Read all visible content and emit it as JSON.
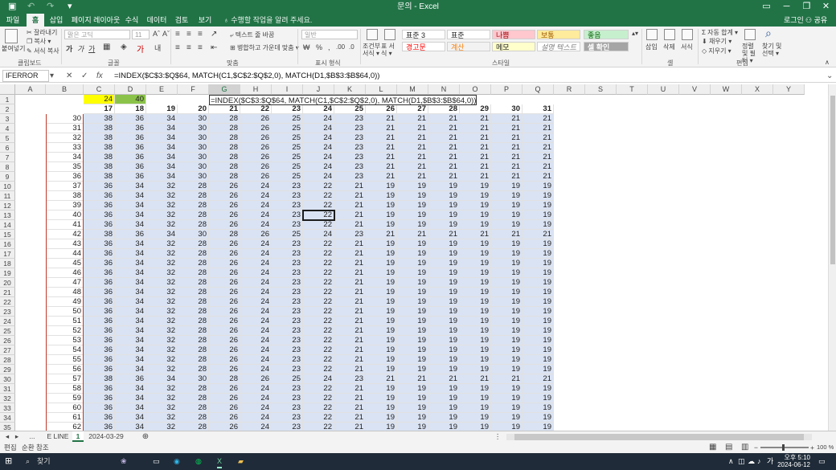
{
  "window": {
    "title": "문의 - Excel"
  },
  "tabs": [
    "파일",
    "홈",
    "삽입",
    "페이지 레이아웃",
    "수식",
    "데이터",
    "검토",
    "보기"
  ],
  "active_tab": "홈",
  "tell_me": "수행할 작업을 알려 주세요.",
  "login": "로그인",
  "share": "공유",
  "ribbon": {
    "paste": "붙여넣기",
    "cut": "잘라내기",
    "copy": "복사 ▾",
    "format_painter": "서식 복사",
    "font_name": "맑은 고딕",
    "font_size": "11",
    "wrap_text": "텍스트 줄 바꿈",
    "merge_center": "병합하고 가운데 맞춤 ▾",
    "number_format": "일반",
    "cond_format": "조건부 서식 ▾",
    "table_format": "표 서식 ▾",
    "styles": [
      {
        "label": "표준 3",
        "bg": "#ffffff",
        "fg": "#222222"
      },
      {
        "label": "표준",
        "bg": "#ffffff",
        "fg": "#222222"
      },
      {
        "label": "나쁨",
        "bg": "#ffc7ce",
        "fg": "#9c0006"
      },
      {
        "label": "보통",
        "bg": "#ffeb9c",
        "fg": "#9c5700"
      },
      {
        "label": "좋음",
        "bg": "#c6efce",
        "fg": "#006100"
      },
      {
        "label": "경고문",
        "bg": "#ffffff",
        "fg": "#ff0000"
      },
      {
        "label": "계산",
        "bg": "#f2f2f2",
        "fg": "#fa7d00"
      },
      {
        "label": "메모",
        "bg": "#ffffcc",
        "fg": "#222222"
      },
      {
        "label": "설명 텍스트",
        "bg": "#ffffff",
        "fg": "#7f7f7f"
      },
      {
        "label": "셀 확인",
        "bg": "#a5a5a5",
        "fg": "#ffffff"
      }
    ],
    "insert": "삽입",
    "delete": "삭제",
    "format": "서식",
    "autosum": "자동 합계 ▾",
    "fill": "채우기 ▾",
    "clear": "지우기 ▾",
    "sort_filter": "정렬 및 필터 ▾",
    "find_select": "찾기 및 선택 ▾",
    "groups": [
      "클립보드",
      "글꼴",
      "맞춤",
      "표시 형식",
      "스타일",
      "셀",
      "편집"
    ]
  },
  "formula_bar": {
    "name_box": "IFERROR",
    "cancel": "✕",
    "enter": "✓",
    "fx": "fx",
    "formula": "=INDEX($C$3:$Q$64, MATCH(C1,$C$2:$Q$2,0), MATCH(D1,$B$3:$B$64,0))"
  },
  "grid": {
    "columns": [
      "A",
      "B",
      "C",
      "D",
      "E",
      "F",
      "G",
      "H",
      "I",
      "J",
      "K",
      "L",
      "M",
      "N",
      "O",
      "P",
      "Q",
      "R",
      "S",
      "T",
      "U",
      "V",
      "W",
      "X",
      "Y"
    ],
    "row_numbers": [
      1,
      2,
      3,
      4,
      5,
      6,
      7,
      8,
      9,
      10,
      11,
      12,
      13,
      14,
      15,
      16,
      17,
      18,
      19,
      20,
      21,
      22,
      23,
      24,
      25,
      26,
      27,
      28,
      29,
      30,
      31,
      32,
      33,
      34,
      35
    ],
    "c1": "24",
    "d1": "40",
    "row2": [
      "17",
      "18",
      "19",
      "20",
      "21",
      "22",
      "23",
      "24",
      "25",
      "26",
      "27",
      "28",
      "29",
      "30",
      "31"
    ],
    "edit_text": "=INDEX($C$3:$Q$64, MATCH(C1,$C$2:$Q$2,0), MATCH(D1,$B$3:$B$64,0))",
    "rows": [
      {
        "b": "30",
        "v": [
          "38",
          "36",
          "34",
          "30",
          "28",
          "26",
          "25",
          "24",
          "23",
          "21",
          "21",
          "21",
          "21",
          "21",
          "21"
        ]
      },
      {
        "b": "31",
        "v": [
          "38",
          "36",
          "34",
          "30",
          "28",
          "26",
          "25",
          "24",
          "23",
          "21",
          "21",
          "21",
          "21",
          "21",
          "21"
        ]
      },
      {
        "b": "32",
        "v": [
          "38",
          "36",
          "34",
          "30",
          "28",
          "26",
          "25",
          "24",
          "23",
          "21",
          "21",
          "21",
          "21",
          "21",
          "21"
        ]
      },
      {
        "b": "33",
        "v": [
          "38",
          "36",
          "34",
          "30",
          "28",
          "26",
          "25",
          "24",
          "23",
          "21",
          "21",
          "21",
          "21",
          "21",
          "21"
        ]
      },
      {
        "b": "34",
        "v": [
          "38",
          "36",
          "34",
          "30",
          "28",
          "26",
          "25",
          "24",
          "23",
          "21",
          "21",
          "21",
          "21",
          "21",
          "21"
        ]
      },
      {
        "b": "35",
        "v": [
          "38",
          "36",
          "34",
          "30",
          "28",
          "26",
          "25",
          "24",
          "23",
          "21",
          "21",
          "21",
          "21",
          "21",
          "21"
        ]
      },
      {
        "b": "36",
        "v": [
          "38",
          "36",
          "34",
          "30",
          "28",
          "26",
          "25",
          "24",
          "23",
          "21",
          "21",
          "21",
          "21",
          "21",
          "21"
        ]
      },
      {
        "b": "37",
        "v": [
          "36",
          "34",
          "32",
          "28",
          "26",
          "24",
          "23",
          "22",
          "21",
          "19",
          "19",
          "19",
          "19",
          "19",
          "19"
        ]
      },
      {
        "b": "38",
        "v": [
          "36",
          "34",
          "32",
          "28",
          "26",
          "24",
          "23",
          "22",
          "21",
          "19",
          "19",
          "19",
          "19",
          "19",
          "19"
        ]
      },
      {
        "b": "39",
        "v": [
          "36",
          "34",
          "32",
          "28",
          "26",
          "24",
          "23",
          "22",
          "21",
          "19",
          "19",
          "19",
          "19",
          "19",
          "19"
        ]
      },
      {
        "b": "40",
        "v": [
          "36",
          "34",
          "32",
          "28",
          "26",
          "24",
          "23",
          "22",
          "21",
          "19",
          "19",
          "19",
          "19",
          "19",
          "19"
        ]
      },
      {
        "b": "41",
        "v": [
          "36",
          "34",
          "32",
          "28",
          "26",
          "24",
          "23",
          "22",
          "21",
          "19",
          "19",
          "19",
          "19",
          "19",
          "19"
        ]
      },
      {
        "b": "42",
        "v": [
          "38",
          "36",
          "34",
          "30",
          "28",
          "26",
          "25",
          "24",
          "23",
          "21",
          "21",
          "21",
          "21",
          "21",
          "21"
        ]
      },
      {
        "b": "43",
        "v": [
          "36",
          "34",
          "32",
          "28",
          "26",
          "24",
          "23",
          "22",
          "21",
          "19",
          "19",
          "19",
          "19",
          "19",
          "19"
        ]
      },
      {
        "b": "44",
        "v": [
          "36",
          "34",
          "32",
          "28",
          "26",
          "24",
          "23",
          "22",
          "21",
          "19",
          "19",
          "19",
          "19",
          "19",
          "19"
        ]
      },
      {
        "b": "45",
        "v": [
          "36",
          "34",
          "32",
          "28",
          "26",
          "24",
          "23",
          "22",
          "21",
          "19",
          "19",
          "19",
          "19",
          "19",
          "19"
        ]
      },
      {
        "b": "46",
        "v": [
          "36",
          "34",
          "32",
          "28",
          "26",
          "24",
          "23",
          "22",
          "21",
          "19",
          "19",
          "19",
          "19",
          "19",
          "19"
        ]
      },
      {
        "b": "47",
        "v": [
          "36",
          "34",
          "32",
          "28",
          "26",
          "24",
          "23",
          "22",
          "21",
          "19",
          "19",
          "19",
          "19",
          "19",
          "19"
        ]
      },
      {
        "b": "48",
        "v": [
          "36",
          "34",
          "32",
          "28",
          "26",
          "24",
          "23",
          "22",
          "21",
          "19",
          "19",
          "19",
          "19",
          "19",
          "19"
        ]
      },
      {
        "b": "49",
        "v": [
          "36",
          "34",
          "32",
          "28",
          "26",
          "24",
          "23",
          "22",
          "21",
          "19",
          "19",
          "19",
          "19",
          "19",
          "19"
        ]
      },
      {
        "b": "50",
        "v": [
          "36",
          "34",
          "32",
          "28",
          "26",
          "24",
          "23",
          "22",
          "21",
          "19",
          "19",
          "19",
          "19",
          "19",
          "19"
        ]
      },
      {
        "b": "51",
        "v": [
          "36",
          "34",
          "32",
          "28",
          "26",
          "24",
          "23",
          "22",
          "21",
          "19",
          "19",
          "19",
          "19",
          "19",
          "19"
        ]
      },
      {
        "b": "52",
        "v": [
          "36",
          "34",
          "32",
          "28",
          "26",
          "24",
          "23",
          "22",
          "21",
          "19",
          "19",
          "19",
          "19",
          "19",
          "19"
        ]
      },
      {
        "b": "53",
        "v": [
          "36",
          "34",
          "32",
          "28",
          "26",
          "24",
          "23",
          "22",
          "21",
          "19",
          "19",
          "19",
          "19",
          "19",
          "19"
        ]
      },
      {
        "b": "54",
        "v": [
          "36",
          "34",
          "32",
          "28",
          "26",
          "24",
          "23",
          "22",
          "21",
          "19",
          "19",
          "19",
          "19",
          "19",
          "19"
        ]
      },
      {
        "b": "55",
        "v": [
          "36",
          "34",
          "32",
          "28",
          "26",
          "24",
          "23",
          "22",
          "21",
          "19",
          "19",
          "19",
          "19",
          "19",
          "19"
        ]
      },
      {
        "b": "56",
        "v": [
          "36",
          "34",
          "32",
          "28",
          "26",
          "24",
          "23",
          "22",
          "21",
          "19",
          "19",
          "19",
          "19",
          "19",
          "19"
        ]
      },
      {
        "b": "57",
        "v": [
          "38",
          "36",
          "34",
          "30",
          "28",
          "26",
          "25",
          "24",
          "23",
          "21",
          "21",
          "21",
          "21",
          "21",
          "21"
        ]
      },
      {
        "b": "58",
        "v": [
          "36",
          "34",
          "32",
          "28",
          "26",
          "24",
          "23",
          "22",
          "21",
          "19",
          "19",
          "19",
          "19",
          "19",
          "19"
        ]
      },
      {
        "b": "59",
        "v": [
          "36",
          "34",
          "32",
          "28",
          "26",
          "24",
          "23",
          "22",
          "21",
          "19",
          "19",
          "19",
          "19",
          "19",
          "19"
        ]
      },
      {
        "b": "60",
        "v": [
          "36",
          "34",
          "32",
          "28",
          "26",
          "24",
          "23",
          "22",
          "21",
          "19",
          "19",
          "19",
          "19",
          "19",
          "19"
        ]
      },
      {
        "b": "61",
        "v": [
          "36",
          "34",
          "32",
          "28",
          "26",
          "24",
          "23",
          "22",
          "21",
          "19",
          "19",
          "19",
          "19",
          "19",
          "19"
        ]
      },
      {
        "b": "62",
        "v": [
          "36",
          "34",
          "32",
          "28",
          "26",
          "24",
          "23",
          "22",
          "21",
          "19",
          "19",
          "19",
          "19",
          "19",
          "19"
        ]
      }
    ]
  },
  "sheet_tabs": [
    "E LINE",
    "1",
    "2024-03-29"
  ],
  "active_sheet": "1",
  "status": {
    "mode": "편집",
    "circular": "순환 참조",
    "zoom": "100 %"
  },
  "taskbar": {
    "search": "찾기",
    "time": "오후 5:10",
    "date": "2024-06-12",
    "lang": "가"
  },
  "colors": {
    "brand": "#217346",
    "blue_fill": "#dae3f3",
    "yellow": "#ffff00",
    "green": "#8bc34a"
  }
}
